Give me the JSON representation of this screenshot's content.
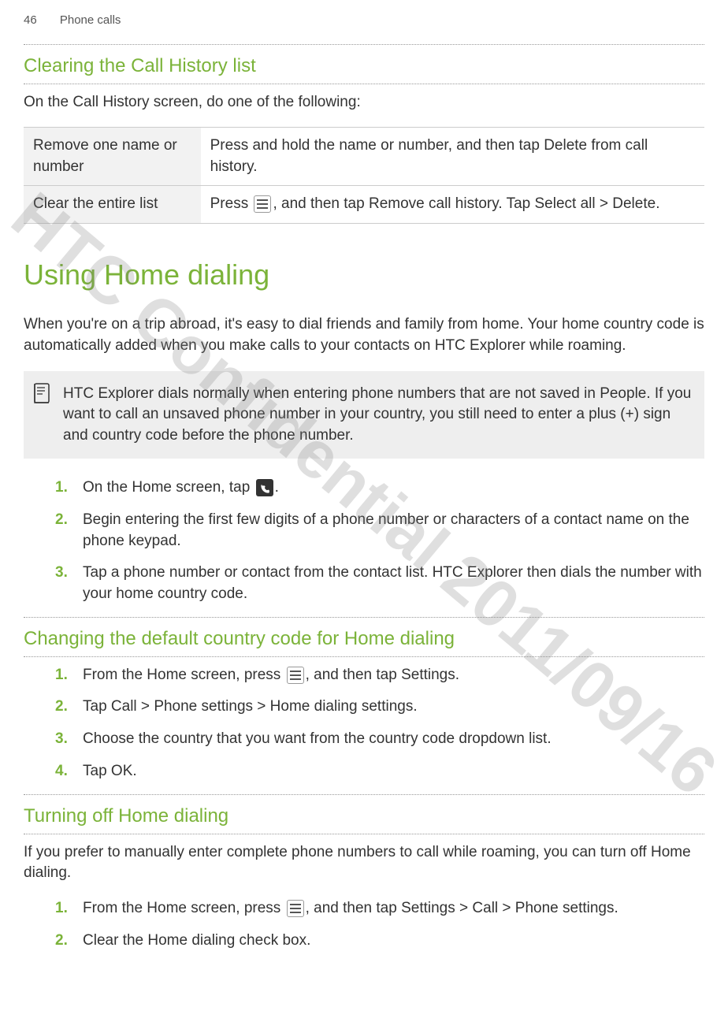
{
  "header": {
    "page_number": "46",
    "section": "Phone calls"
  },
  "watermark": "HTC Confidential  2011/09/16",
  "sec_clear": {
    "title": "Clearing the Call History list",
    "intro": "On the Call History screen, do one of the following:",
    "table": {
      "row1_left": "Remove one name or number",
      "row1_right_a": "Press and hold the name or number, and then tap ",
      "row1_right_b": "Delete from call history",
      "row1_right_c": ".",
      "row2_left": "Clear the entire list",
      "row2_right_a": "Press ",
      "row2_right_b": ", and then tap ",
      "row2_right_c": "Remove call history",
      "row2_right_d": ". Tap ",
      "row2_right_e": "Select all",
      "row2_right_f": " > ",
      "row2_right_g": "Delete",
      "row2_right_h": "."
    }
  },
  "sec_home": {
    "title": "Using Home dialing",
    "para": "When you're on a trip abroad, it's easy to dial friends and family from home. Your home country code is automatically added when you make calls to your contacts on HTC Explorer while roaming.",
    "note": "HTC Explorer dials normally when entering phone numbers that are not saved in People. If you want to call an unsaved phone number in your country, you still need to enter a plus (+) sign and country code before the phone number.",
    "steps": {
      "s1_a": "On the Home screen, tap ",
      "s1_b": ".",
      "s2": "Begin entering the first few digits of a phone number or characters of a contact name on the phone keypad.",
      "s3": "Tap a phone number or contact from the contact list. HTC Explorer then dials the number with your home country code."
    }
  },
  "sec_change": {
    "title": "Changing the default country code for Home dialing",
    "steps": {
      "s1_a": "From the Home screen, press ",
      "s1_b": ", and then tap ",
      "s1_c": "Settings",
      "s1_d": ".",
      "s2_a": "Tap ",
      "s2_b": "Call",
      "s2_c": " > ",
      "s2_d": "Phone settings",
      "s2_e": " > ",
      "s2_f": "Home dialing settings",
      "s2_g": ".",
      "s3": "Choose the country that you want from the country code dropdown list.",
      "s4_a": "Tap ",
      "s4_b": "OK",
      "s4_c": "."
    }
  },
  "sec_turnoff": {
    "title": "Turning off Home dialing",
    "para": "If you prefer to manually enter complete phone numbers to call while roaming, you can turn off Home dialing.",
    "steps": {
      "s1_a": "From the Home screen, press ",
      "s1_b": ", and then tap ",
      "s1_c": "Settings",
      "s1_d": " > ",
      "s1_e": "Call",
      "s1_f": " > ",
      "s1_g": "Phone settings",
      "s1_h": ".",
      "s2_a": "Clear the ",
      "s2_b": "Home dialing",
      "s2_c": " check box."
    }
  }
}
